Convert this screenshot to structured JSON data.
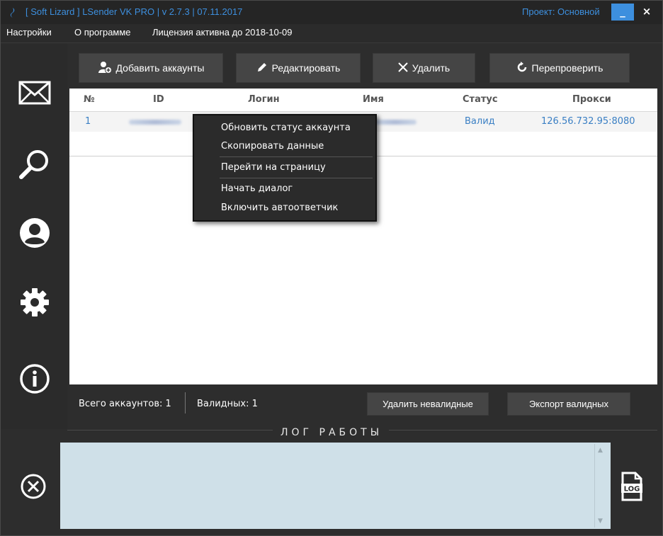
{
  "window": {
    "title": "[ Soft Lizard ] LSender VK PRO | v 2.7.3 | 07.11.2017",
    "project": "Проект: Основной",
    "minimize_glyph": "_",
    "close_glyph": "×"
  },
  "menu": {
    "items": [
      "Настройки",
      "О программе",
      "Лицензия активна до 2018-10-09"
    ]
  },
  "sidebar": {
    "icons": [
      "mail-icon",
      "search-icon",
      "user-circle-icon",
      "gear-icon",
      "info-icon"
    ]
  },
  "toolbar": {
    "add_label": "Добавить аккаунты",
    "edit_label": "Редактировать",
    "delete_label": "Удалить",
    "recheck_label": "Перепроверить"
  },
  "table": {
    "columns": [
      "№",
      "ID",
      "Логин",
      "Имя",
      "Статус",
      "Прокси"
    ],
    "rows": [
      {
        "num": "1",
        "status": "Валид",
        "proxy": "126.56.732.95:8080"
      }
    ]
  },
  "context_menu": {
    "items": [
      "Обновить статус аккаунта",
      "Скопировать данные",
      "Перейти на страницу",
      "Начать диалог",
      "Включить автоответчик"
    ]
  },
  "footer": {
    "total_accounts": "Всего аккаунтов: 1",
    "valid_count": "Валидных: 1",
    "delete_invalid_label": "Удалить невалидные",
    "export_valid_label": "Экспорт валидных"
  },
  "log": {
    "title": "ЛОГ РАБОТЫ",
    "log_icon_label": "LOG"
  },
  "colors": {
    "accent": "#3d8fde",
    "background": "#2d2d2d",
    "button": "#454545",
    "log_box": "#cfe0e8",
    "link": "#3a7fc4"
  }
}
